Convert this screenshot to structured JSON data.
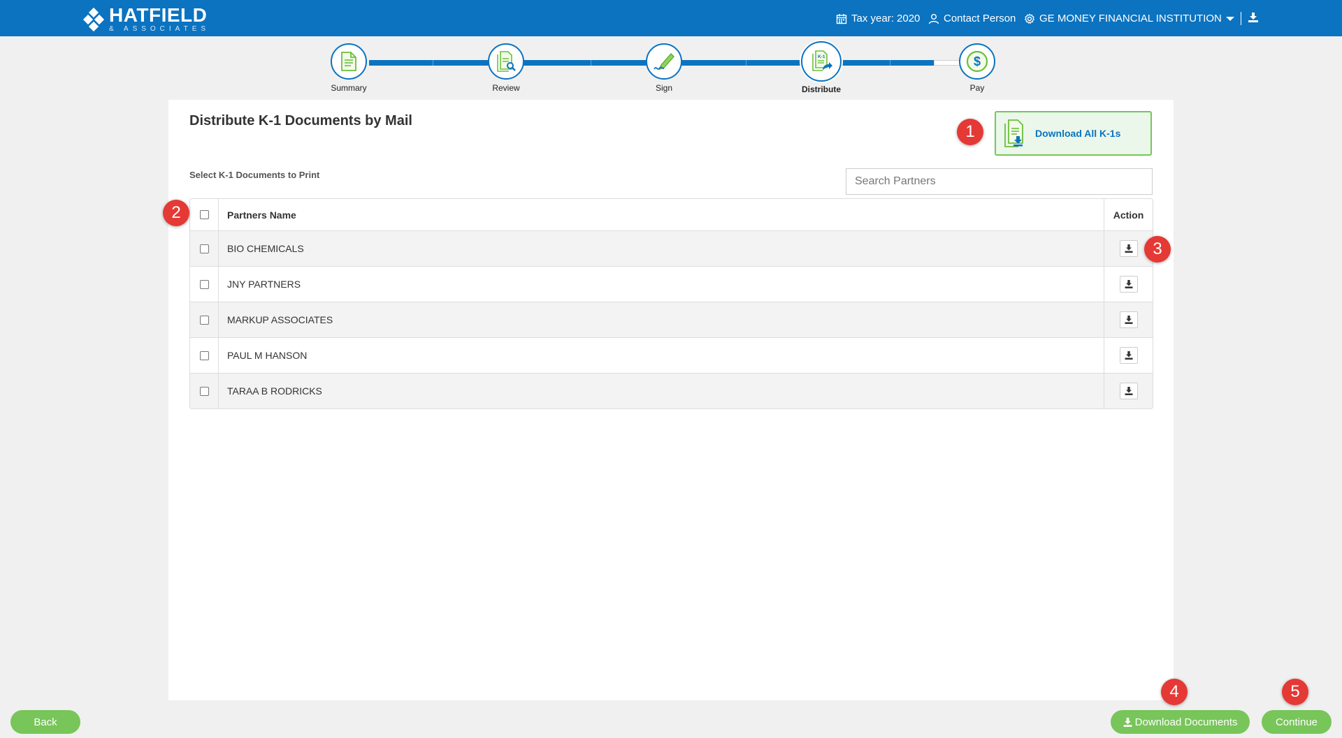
{
  "header": {
    "brand_name": "HATFIELD",
    "brand_sub": "& ASSOCIATES",
    "tax_year": "Tax year: 2020",
    "contact": "Contact Person",
    "institution": "GE MONEY FINANCIAL INSTITUTION"
  },
  "steps": [
    {
      "label": "Summary",
      "icon": "document-icon"
    },
    {
      "label": "Review",
      "icon": "document-search-icon"
    },
    {
      "label": "Sign",
      "icon": "pen-sign-icon"
    },
    {
      "label": "Distribute",
      "icon": "k1-share-icon"
    },
    {
      "label": "Pay",
      "icon": "dollar-icon"
    }
  ],
  "active_step": "Distribute",
  "page": {
    "title": "Distribute K-1 Documents by Mail",
    "download_all_label": "Download All K-1s",
    "subtitle": "Select K-1 Documents to Print",
    "search_placeholder": "Search Partners"
  },
  "table": {
    "columns": [
      "Partners Name",
      "Action"
    ],
    "rows": [
      {
        "name": "BIO CHEMICALS"
      },
      {
        "name": "JNY PARTNERS"
      },
      {
        "name": "MARKUP ASSOCIATES"
      },
      {
        "name": "PAUL M HANSON"
      },
      {
        "name": "TARAA B RODRICKS"
      }
    ]
  },
  "footer": {
    "back_label": "Back",
    "download_documents_label": "Download Documents",
    "continue_label": "Continue"
  },
  "markers": [
    "1",
    "2",
    "3",
    "4",
    "5"
  ],
  "colors": {
    "header_blue": "#0b73c0",
    "accent_green": "#78c55a",
    "marker_red": "#e53935"
  }
}
